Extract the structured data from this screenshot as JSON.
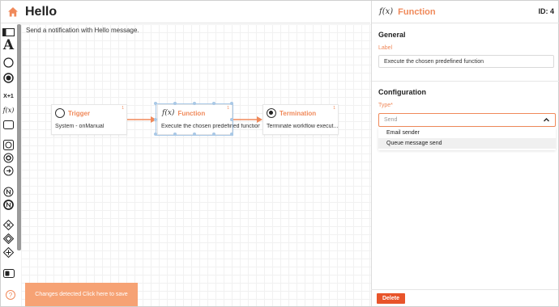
{
  "header": {
    "title": "Hello",
    "home_icon": "home-icon"
  },
  "canvas": {
    "description": "Send a notification with Hello message.",
    "nodes": [
      {
        "id": "trigger",
        "title": "Trigger",
        "body": "System - onManual",
        "badge": "1",
        "icon": "circle-outline-icon"
      },
      {
        "id": "function",
        "title": "Function",
        "body": "Execute the chosen predefined function",
        "badge": "1",
        "icon": "fx-icon"
      },
      {
        "id": "termination",
        "title": "Termination",
        "body": "Terminate workflow execut...",
        "badge": "1",
        "icon": "circle-filled-icon"
      }
    ],
    "changes_button": "Changes detected Click here to save",
    "help": "?"
  },
  "toolbar": {
    "items": [
      "panel-toggle-icon",
      "text-tool-icon",
      "circle-tool-icon",
      "filled-circle-tool-icon",
      "counter-tool-icon",
      "fx-tool-icon",
      "rectangle-tool-icon",
      "loop-icon",
      "gear-circle-icon",
      "arrow-circle-icon",
      "n-circle-icon",
      "n-filled-circle-icon",
      "diamond-x-icon",
      "diamond-icon",
      "diamond-plus-icon",
      "toggle-icon"
    ],
    "counter_label": "X+1",
    "fx_label": "f(x)"
  },
  "panel": {
    "fx_label": "f(x)",
    "title": "Function",
    "id_label": "ID: 4",
    "general_title": "General",
    "label_field_label": "Label",
    "label_field_value": "Execute the chosen predefined function",
    "configuration_title": "Configuration",
    "type_field_label": "Type*",
    "type_placeholder": "Send",
    "options": [
      "Email sender",
      "Queue message send"
    ],
    "delete_label": "Delete"
  },
  "colors": {
    "accent": "#f0895a",
    "delete": "#e8542a",
    "changes": "#f6a274",
    "selection": "#a9c8e6"
  }
}
